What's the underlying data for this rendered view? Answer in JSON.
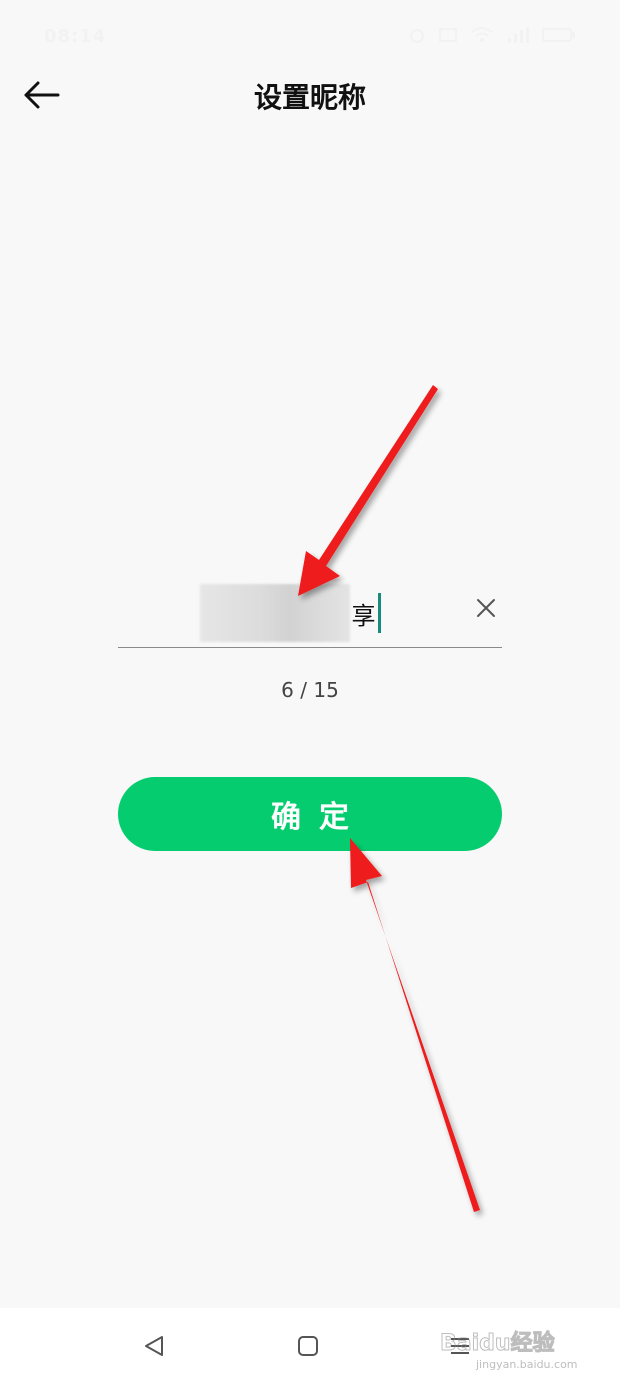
{
  "status": {
    "time": "08:14"
  },
  "header": {
    "title": "设置昵称",
    "back_icon": "arrow-left-icon"
  },
  "nickname": {
    "visible_tail": "享",
    "clear_icon": "close-icon"
  },
  "counter": {
    "text": "6 / 15"
  },
  "confirm": {
    "label": "确定",
    "color": "#05cd6f"
  },
  "navbar": {
    "back_icon": "triangle-back-icon",
    "home_icon": "square-home-icon",
    "menu_icon": "menu-lines-icon"
  },
  "watermark": {
    "text": "Baidu经验",
    "subtext": "jingyan.baidu.com"
  }
}
